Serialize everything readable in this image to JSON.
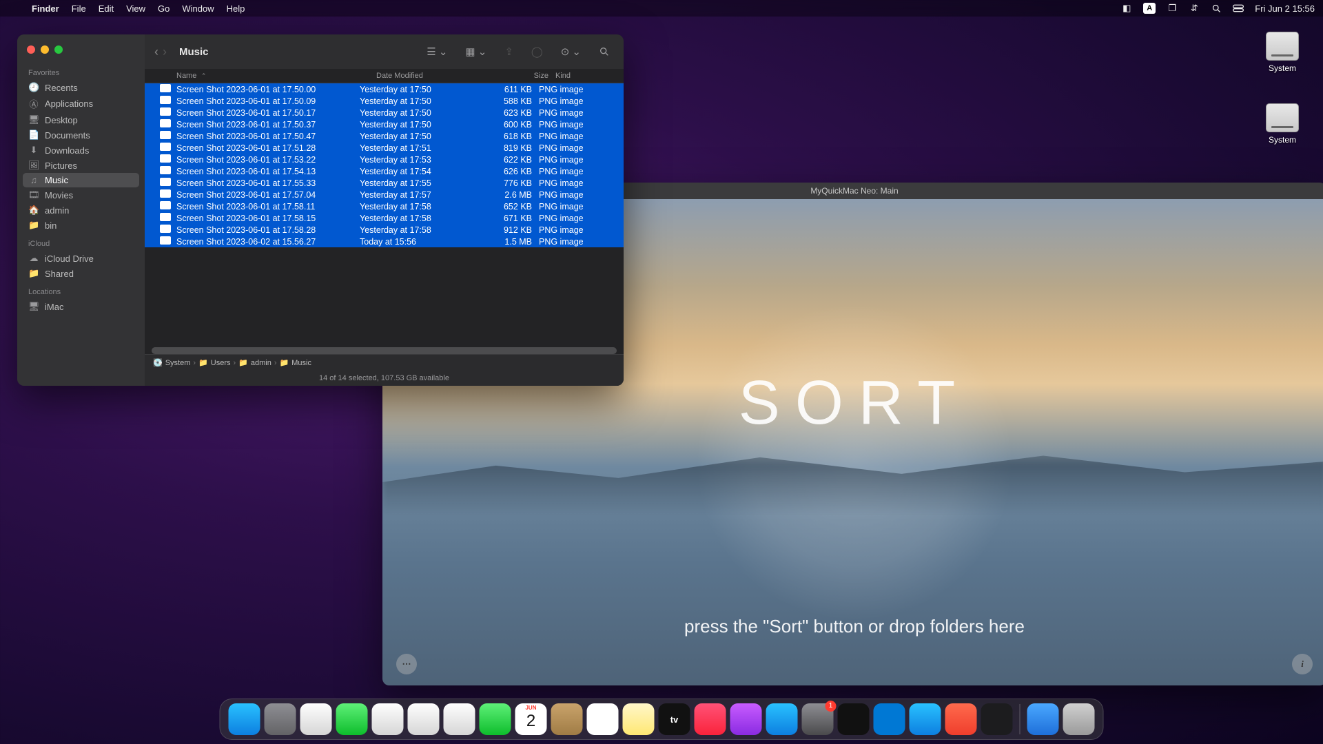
{
  "menubar": {
    "app": "Finder",
    "items": [
      "File",
      "Edit",
      "View",
      "Go",
      "Window",
      "Help"
    ],
    "clock": "Fri Jun 2  15:56"
  },
  "desktop": {
    "drives": [
      {
        "label": "System"
      },
      {
        "label": "System"
      }
    ]
  },
  "finder": {
    "title": "Music",
    "sidebar": {
      "favorites_label": "Favorites",
      "favorites": [
        {
          "icon": "clock",
          "label": "Recents"
        },
        {
          "icon": "app",
          "label": "Applications"
        },
        {
          "icon": "desktop",
          "label": "Desktop"
        },
        {
          "icon": "doc",
          "label": "Documents"
        },
        {
          "icon": "download",
          "label": "Downloads"
        },
        {
          "icon": "pic",
          "label": "Pictures"
        },
        {
          "icon": "music",
          "label": "Music",
          "active": true
        },
        {
          "icon": "movie",
          "label": "Movies"
        },
        {
          "icon": "home",
          "label": "admin"
        },
        {
          "icon": "folder",
          "label": "bin"
        }
      ],
      "icloud_label": "iCloud",
      "icloud": [
        {
          "icon": "cloud",
          "label": "iCloud Drive"
        },
        {
          "icon": "shared",
          "label": "Shared"
        }
      ],
      "locations_label": "Locations",
      "locations": [
        {
          "icon": "imac",
          "label": "iMac"
        }
      ]
    },
    "columns": {
      "name": "Name",
      "date": "Date Modified",
      "size": "Size",
      "kind": "Kind"
    },
    "files": [
      {
        "name": "Screen Shot 2023-06-01 at 17.50.00",
        "date": "Yesterday at 17:50",
        "size": "611 KB",
        "kind": "PNG image"
      },
      {
        "name": "Screen Shot 2023-06-01 at 17.50.09",
        "date": "Yesterday at 17:50",
        "size": "588 KB",
        "kind": "PNG image"
      },
      {
        "name": "Screen Shot 2023-06-01 at 17.50.17",
        "date": "Yesterday at 17:50",
        "size": "623 KB",
        "kind": "PNG image"
      },
      {
        "name": "Screen Shot 2023-06-01 at 17.50.37",
        "date": "Yesterday at 17:50",
        "size": "600 KB",
        "kind": "PNG image"
      },
      {
        "name": "Screen Shot 2023-06-01 at 17.50.47",
        "date": "Yesterday at 17:50",
        "size": "618 KB",
        "kind": "PNG image"
      },
      {
        "name": "Screen Shot 2023-06-01 at 17.51.28",
        "date": "Yesterday at 17:51",
        "size": "819 KB",
        "kind": "PNG image"
      },
      {
        "name": "Screen Shot 2023-06-01 at 17.53.22",
        "date": "Yesterday at 17:53",
        "size": "622 KB",
        "kind": "PNG image"
      },
      {
        "name": "Screen Shot 2023-06-01 at 17.54.13",
        "date": "Yesterday at 17:54",
        "size": "626 KB",
        "kind": "PNG image"
      },
      {
        "name": "Screen Shot 2023-06-01 at 17.55.33",
        "date": "Yesterday at 17:55",
        "size": "776 KB",
        "kind": "PNG image"
      },
      {
        "name": "Screen Shot 2023-06-01 at 17.57.04",
        "date": "Yesterday at 17:57",
        "size": "2.6 MB",
        "kind": "PNG image"
      },
      {
        "name": "Screen Shot 2023-06-01 at 17.58.11",
        "date": "Yesterday at 17:58",
        "size": "652 KB",
        "kind": "PNG image"
      },
      {
        "name": "Screen Shot 2023-06-01 at 17.58.15",
        "date": "Yesterday at 17:58",
        "size": "671 KB",
        "kind": "PNG image"
      },
      {
        "name": "Screen Shot 2023-06-01 at 17.58.28",
        "date": "Yesterday at 17:58",
        "size": "912 KB",
        "kind": "PNG image"
      },
      {
        "name": "Screen Shot 2023-06-02 at 15.56.27",
        "date": "Today at 15:56",
        "size": "1.5 MB",
        "kind": "PNG image"
      }
    ],
    "path": [
      "System",
      "Users",
      "admin",
      "Music"
    ],
    "status": "14 of 14 selected, 107.53 GB available"
  },
  "app": {
    "title": "MyQuickMac Neo: Main",
    "heading": "SORT",
    "hint": "press the \"Sort\" button or drop folders here"
  },
  "dock": {
    "items": [
      {
        "name": "finder",
        "bg": "linear-gradient(#29c1ff,#0d7fe0)"
      },
      {
        "name": "launchpad",
        "bg": "linear-gradient(#8e8e93,#636366)"
      },
      {
        "name": "safari",
        "bg": "linear-gradient(#fefefe,#d6d6d6)"
      },
      {
        "name": "messages",
        "bg": "linear-gradient(#5ef078,#0ebd2c)"
      },
      {
        "name": "mail",
        "bg": "linear-gradient(#fefefe,#d6d6d6)"
      },
      {
        "name": "maps",
        "bg": "linear-gradient(#fefefe,#d6d6d6)"
      },
      {
        "name": "photos",
        "bg": "linear-gradient(#fefefe,#d6d6d6)"
      },
      {
        "name": "facetime",
        "bg": "linear-gradient(#5ef078,#0ebd2c)"
      },
      {
        "name": "calendar",
        "bg": "#fff",
        "text": "2",
        "top": "JUN"
      },
      {
        "name": "contacts",
        "bg": "linear-gradient(#c9a36b,#a07c45)"
      },
      {
        "name": "reminders",
        "bg": "#fff"
      },
      {
        "name": "notes",
        "bg": "linear-gradient(#fff6c9,#ffe873)"
      },
      {
        "name": "appletv",
        "bg": "#111",
        "label": "tv"
      },
      {
        "name": "music",
        "bg": "linear-gradient(#ff5277,#fa233b)"
      },
      {
        "name": "podcasts",
        "bg": "linear-gradient(#c85cff,#8a2be2)"
      },
      {
        "name": "appstore",
        "bg": "linear-gradient(#29c1ff,#0d7fe0)"
      },
      {
        "name": "settings",
        "bg": "linear-gradient(#8e8e93,#4a4a4c)",
        "badge": "1"
      },
      {
        "name": "terminal",
        "bg": "#111"
      },
      {
        "name": "vscode",
        "bg": "#0078d4"
      },
      {
        "name": "telegram",
        "bg": "linear-gradient(#29c1ff,#0d7fe0)"
      },
      {
        "name": "anydesk",
        "bg": "linear-gradient(#ff6a4d,#ef3e2c)"
      },
      {
        "name": "app-dark",
        "bg": "#1c1c1e"
      }
    ],
    "right": [
      {
        "name": "downloads",
        "bg": "linear-gradient(#4aa8ff,#1e6fd9)"
      },
      {
        "name": "trash",
        "bg": "linear-gradient(#d0d0d0,#9a9a9a)"
      }
    ]
  }
}
